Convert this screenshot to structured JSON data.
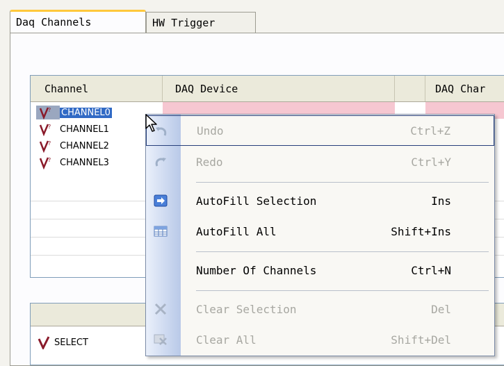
{
  "tabs": [
    {
      "label": "Daq Channels",
      "active": true
    },
    {
      "label": "HW Trigger",
      "active": false
    }
  ],
  "grid": {
    "headers": [
      "Channel",
      "DAQ Device",
      "DAQ Char"
    ],
    "rows": [
      {
        "label": "CHANNEL0",
        "selected": true
      },
      {
        "label": "CHANNEL1",
        "selected": false
      },
      {
        "label": "CHANNEL2",
        "selected": false
      },
      {
        "label": "CHANNEL3",
        "selected": false
      }
    ]
  },
  "grid2": {
    "rows": [
      {
        "label": "SELECT"
      }
    ]
  },
  "context_menu": {
    "items": [
      {
        "label": "Undo",
        "shortcut": "Ctrl+Z",
        "enabled": false,
        "icon": "undo-icon"
      },
      {
        "label": "Redo",
        "shortcut": "Ctrl+Y",
        "enabled": false,
        "icon": "redo-icon"
      },
      {
        "label": "AutoFill Selection",
        "shortcut": "Ins",
        "enabled": true,
        "icon": "autofill-selection-icon"
      },
      {
        "label": "AutoFill All",
        "shortcut": "Shift+Ins",
        "enabled": true,
        "icon": "autofill-all-icon"
      },
      {
        "label": "Number Of Channels",
        "shortcut": "Ctrl+N",
        "enabled": true,
        "icon": ""
      },
      {
        "label": "Clear Selection",
        "shortcut": "Del",
        "enabled": false,
        "icon": "clear-selection-icon"
      },
      {
        "label": "Clear All",
        "shortcut": "Shift+Del",
        "enabled": false,
        "icon": "clear-all-icon"
      }
    ]
  },
  "colors": {
    "tab_accent": "#ffc83c",
    "selection": "#316ac5",
    "row_pink": "#f6c7d1",
    "menu_highlight_border": "#273f7b"
  }
}
